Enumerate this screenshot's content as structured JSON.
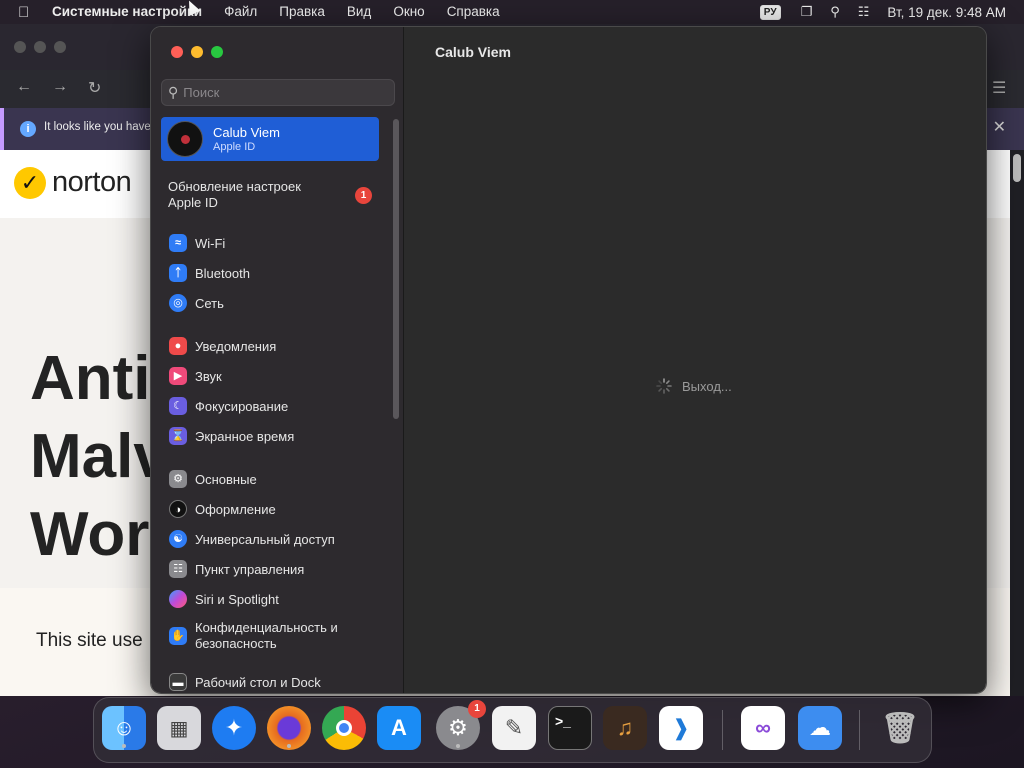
{
  "menubar": {
    "app_name": "Системные настройки",
    "menus": [
      "Файл",
      "Правка",
      "Вид",
      "Окно",
      "Справка"
    ],
    "input_source": "РУ",
    "datetime": "Вт, 19 дек.  9:48 AM"
  },
  "browser": {
    "notice_text": "It looks like you have",
    "brand": "norton",
    "hero_lines": [
      "Anti",
      "Malv",
      "Wor"
    ],
    "cookie_text": "This site use"
  },
  "settings": {
    "search_placeholder": "Поиск",
    "account": {
      "name": "Calub Viem",
      "subtitle": "Apple ID"
    },
    "update": {
      "label_line1": "Обновление настроек",
      "label_line2": "Apple ID",
      "badge": "1"
    },
    "groups": [
      [
        {
          "label": "Wi-Fi",
          "icon": "wifi-icon",
          "color": "#2f7cf6"
        },
        {
          "label": "Bluetooth",
          "icon": "bluetooth-icon",
          "color": "#2f7cf6"
        },
        {
          "label": "Сеть",
          "icon": "globe-icon",
          "color": "#2f7cf6"
        }
      ],
      [
        {
          "label": "Уведомления",
          "icon": "bell-icon",
          "color": "#ef4a4a"
        },
        {
          "label": "Звук",
          "icon": "speaker-icon",
          "color": "#ef4a7a"
        },
        {
          "label": "Фокусирование",
          "icon": "moon-icon",
          "color": "#6a5ee0"
        },
        {
          "label": "Экранное время",
          "icon": "hourglass-icon",
          "color": "#6a5ee0"
        }
      ],
      [
        {
          "label": "Основные",
          "icon": "gear-icon",
          "color": "#8a8a8e"
        },
        {
          "label": "Оформление",
          "icon": "appearance-icon",
          "color": "#111111"
        },
        {
          "label": "Универсальный доступ",
          "icon": "accessibility-icon",
          "color": "#2f7cf6"
        },
        {
          "label": "Пункт управления",
          "icon": "control-center-icon",
          "color": "#8a8a8e"
        },
        {
          "label": "Siri и Spotlight",
          "icon": "siri-icon",
          "color": "#a04ad8"
        },
        {
          "label": "Конфиденциальность и безопасность",
          "label_line1": "Конфиденциальность и",
          "label_line2": "безопасность",
          "icon": "hand-icon",
          "color": "#2f7cf6"
        }
      ],
      [
        {
          "label": "Рабочий стол и Dock",
          "icon": "dock-icon",
          "color": "#3a3a3a"
        }
      ]
    ],
    "main_title": "Calub Viem",
    "loading_text": "Выход..."
  },
  "dock": {
    "apps": [
      {
        "name": "finder-icon",
        "color": "#3a8cf0",
        "running": true
      },
      {
        "name": "launchpad-icon",
        "color": "#c8c8cc",
        "running": false
      },
      {
        "name": "safari-icon",
        "color": "#1e7cf2",
        "running": false
      },
      {
        "name": "firefox-icon",
        "color": "#e66b1f",
        "running": true
      },
      {
        "name": "chrome-icon",
        "color": "#ffffff",
        "running": false
      },
      {
        "name": "app-store-icon",
        "color": "#1a8cf5",
        "running": false
      },
      {
        "name": "system-settings-icon",
        "color": "#8a8a8e",
        "running": true,
        "badge": "1"
      },
      {
        "name": "textedit-icon",
        "color": "#f2f2f2",
        "running": false
      },
      {
        "name": "terminal-icon",
        "color": "#1a1a1a",
        "running": false
      },
      {
        "name": "garageband-icon",
        "color": "#3a2a20",
        "running": false
      },
      {
        "name": "vscode-icon",
        "color": "#ffffff",
        "running": false
      },
      {
        "name": "visual-studio-icon",
        "color": "#ffffff",
        "running": false
      },
      {
        "name": "weather-icon",
        "color": "#3d8df0",
        "running": false
      },
      {
        "name": "trash-icon",
        "color": "#9a9a9a",
        "running": false
      }
    ]
  }
}
